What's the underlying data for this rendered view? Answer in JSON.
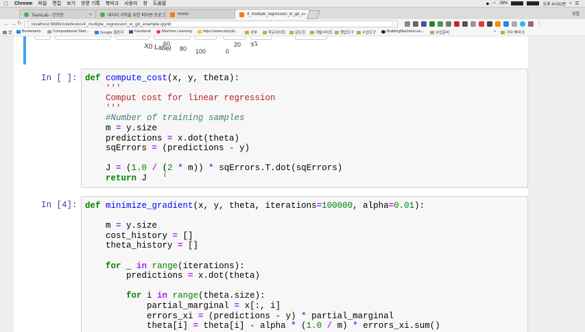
{
  "menubar": {
    "app": "Chrome",
    "items": [
      "파일",
      "편집",
      "보기",
      "방문 기록",
      "북마크",
      "사용자",
      "창",
      "도움말"
    ],
    "battery": "28%",
    "clock": "오후 4시31분"
  },
  "tabs": [
    {
      "title": "TeamLab - 인프런",
      "active": false
    },
    {
      "title": "데이터 과학을 위한 파이썬 프로그래밍",
      "active": false
    },
    {
      "title": "Home",
      "active": false
    },
    {
      "title": "4_multiple_regression_w_gd_example",
      "active": true
    }
  ],
  "profile": "성철",
  "url": "localhost:8888/notebooks/4_multiple_regression_w_gd_example.ipynb",
  "bookmarks": {
    "apps": "앱",
    "items": [
      "Bookmarks",
      "Computational Stati...",
      "Google 캘린더",
      "Facebook",
      "Machine Learning",
      "https://www.storybl...",
      "공부",
      "학교사이트",
      "금도린",
      "개발사이트",
      "챙업도구",
      "수업도구",
      "BuildingMachineLea...",
      "수업준비"
    ],
    "other": "기타 북마크"
  },
  "plot_axis": {
    "xlabel": "X0 Label",
    "ticks_a": [
      "60",
      "80",
      "100"
    ],
    "ticks_b": [
      "0",
      "20"
    ],
    "other": "X1"
  },
  "cells": [
    {
      "prompt": "In [ ]:",
      "lines": [
        [
          {
            "t": "def",
            "c": "kw"
          },
          {
            "t": " "
          },
          {
            "t": "compute_cost",
            "c": "fn"
          },
          {
            "t": "(x, y, theta):"
          }
        ],
        [
          {
            "t": "    "
          },
          {
            "t": "'''",
            "c": "str"
          }
        ],
        [
          {
            "t": "    "
          },
          {
            "t": "Comput cost for linear regression",
            "c": "str"
          }
        ],
        [
          {
            "t": "    "
          },
          {
            "t": "'''",
            "c": "str"
          }
        ],
        [
          {
            "t": "    "
          },
          {
            "t": "#Number of training samples",
            "c": "cm"
          }
        ],
        [
          {
            "t": "    m "
          },
          {
            "t": "=",
            "c": "op"
          },
          {
            "t": " y.size"
          }
        ],
        [
          {
            "t": "    predictions "
          },
          {
            "t": "=",
            "c": "op"
          },
          {
            "t": " x.dot(theta)"
          }
        ],
        [
          {
            "t": "    sqErrors "
          },
          {
            "t": "=",
            "c": "op"
          },
          {
            "t": " (predictions "
          },
          {
            "t": "-",
            "c": "op"
          },
          {
            "t": " y)"
          }
        ],
        [
          {
            "t": ""
          }
        ],
        [
          {
            "t": "    J "
          },
          {
            "t": "=",
            "c": "op"
          },
          {
            "t": " ("
          },
          {
            "t": "1.0",
            "c": "num"
          },
          {
            "t": " "
          },
          {
            "t": "/",
            "c": "op"
          },
          {
            "t": " ("
          },
          {
            "t": "2",
            "c": "num"
          },
          {
            "t": " "
          },
          {
            "t": "*",
            "c": "op"
          },
          {
            "t": " m)) "
          },
          {
            "t": "*",
            "c": "op"
          },
          {
            "t": " sqErrors.T.dot(sqErrors)"
          }
        ],
        [
          {
            "t": "    "
          },
          {
            "t": "return",
            "c": "kw"
          },
          {
            "t": " J"
          }
        ]
      ]
    },
    {
      "prompt": "In [4]:",
      "lines": [
        [
          {
            "t": "def",
            "c": "kw"
          },
          {
            "t": " "
          },
          {
            "t": "minimize_gradient",
            "c": "fn"
          },
          {
            "t": "(x, y, theta, iterations"
          },
          {
            "t": "=",
            "c": "op"
          },
          {
            "t": "100000",
            "c": "num"
          },
          {
            "t": ", alpha"
          },
          {
            "t": "=",
            "c": "op"
          },
          {
            "t": "0.01",
            "c": "num"
          },
          {
            "t": "):"
          }
        ],
        [
          {
            "t": ""
          }
        ],
        [
          {
            "t": "    m "
          },
          {
            "t": "=",
            "c": "op"
          },
          {
            "t": " y.size"
          }
        ],
        [
          {
            "t": "    cost_history "
          },
          {
            "t": "=",
            "c": "op"
          },
          {
            "t": " []"
          }
        ],
        [
          {
            "t": "    theta_history "
          },
          {
            "t": "=",
            "c": "op"
          },
          {
            "t": " []"
          }
        ],
        [
          {
            "t": ""
          }
        ],
        [
          {
            "t": "    "
          },
          {
            "t": "for",
            "c": "kw"
          },
          {
            "t": " _ "
          },
          {
            "t": "in",
            "c": "op"
          },
          {
            "t": " "
          },
          {
            "t": "range",
            "c": "bi2"
          },
          {
            "t": "(iterations):"
          }
        ],
        [
          {
            "t": "        predictions "
          },
          {
            "t": "=",
            "c": "op"
          },
          {
            "t": " x.dot(theta)"
          }
        ],
        [
          {
            "t": ""
          }
        ],
        [
          {
            "t": "        "
          },
          {
            "t": "for",
            "c": "kw"
          },
          {
            "t": " i "
          },
          {
            "t": "in",
            "c": "op"
          },
          {
            "t": " "
          },
          {
            "t": "range",
            "c": "bi2"
          },
          {
            "t": "(theta.size):"
          }
        ],
        [
          {
            "t": "            partial_marginal "
          },
          {
            "t": "=",
            "c": "op"
          },
          {
            "t": " x[:, i]"
          }
        ],
        [
          {
            "t": "            errors_xi "
          },
          {
            "t": "=",
            "c": "op"
          },
          {
            "t": " (predictions "
          },
          {
            "t": "-",
            "c": "op"
          },
          {
            "t": " y) "
          },
          {
            "t": "*",
            "c": "op"
          },
          {
            "t": " partial_marginal"
          }
        ],
        [
          {
            "t": "            theta[i] "
          },
          {
            "t": "=",
            "c": "op"
          },
          {
            "t": " theta[i] "
          },
          {
            "t": "-",
            "c": "op"
          },
          {
            "t": " alpha "
          },
          {
            "t": "*",
            "c": "op"
          },
          {
            "t": " ("
          },
          {
            "t": "1.0",
            "c": "num"
          },
          {
            "t": " "
          },
          {
            "t": "/",
            "c": "op"
          },
          {
            "t": " m) "
          },
          {
            "t": "*",
            "c": "op"
          },
          {
            "t": " errors_xi.sum()"
          }
        ]
      ]
    }
  ]
}
